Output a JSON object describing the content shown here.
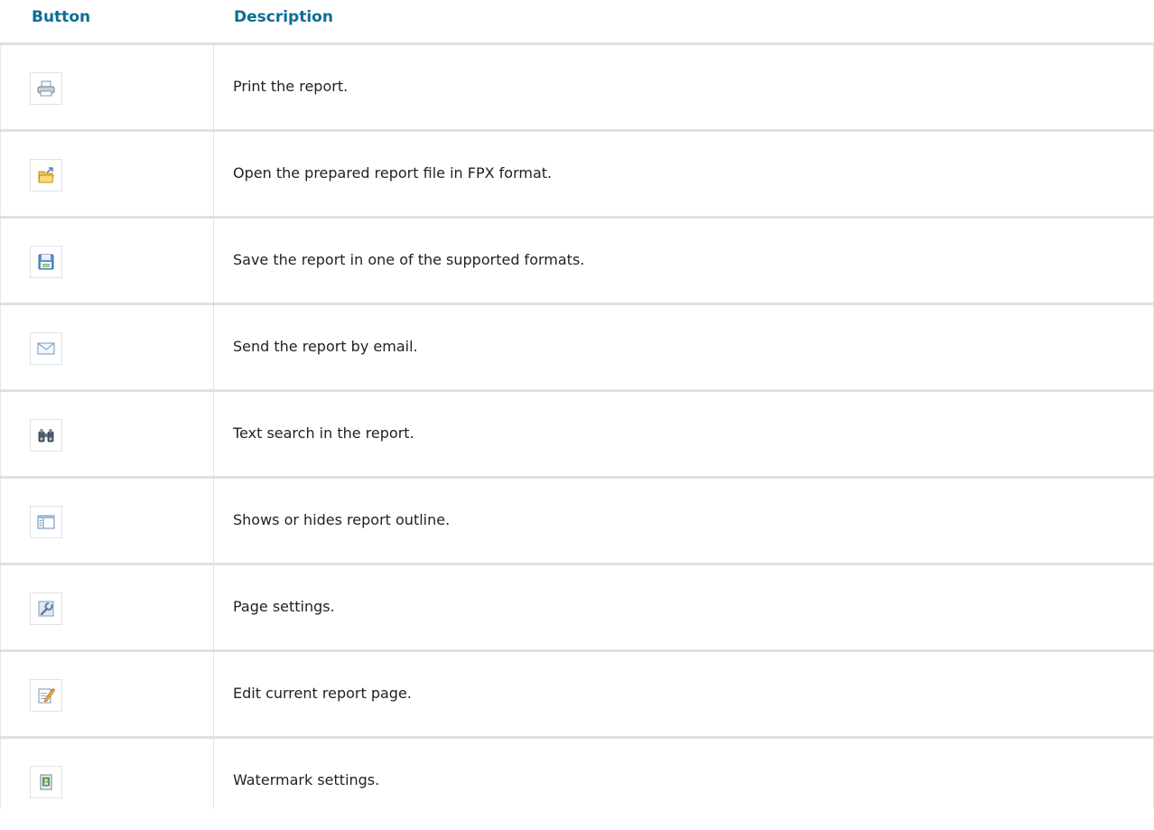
{
  "header": {
    "button": "Button",
    "description": "Description"
  },
  "rows": [
    {
      "icon": "printer-icon",
      "description": "Print the report."
    },
    {
      "icon": "open-folder-icon",
      "description": "Open the prepared report file in FPX format."
    },
    {
      "icon": "save-icon",
      "description": "Save the report in one of the supported formats."
    },
    {
      "icon": "email-icon",
      "description": "Send the report by email."
    },
    {
      "icon": "binoculars-icon",
      "description": "Text search in the report."
    },
    {
      "icon": "outline-icon",
      "description": "Shows or hides report outline."
    },
    {
      "icon": "page-settings-icon",
      "description": "Page settings."
    },
    {
      "icon": "edit-page-icon",
      "description": "Edit current report page."
    },
    {
      "icon": "watermark-icon",
      "description": "Watermark settings."
    }
  ]
}
